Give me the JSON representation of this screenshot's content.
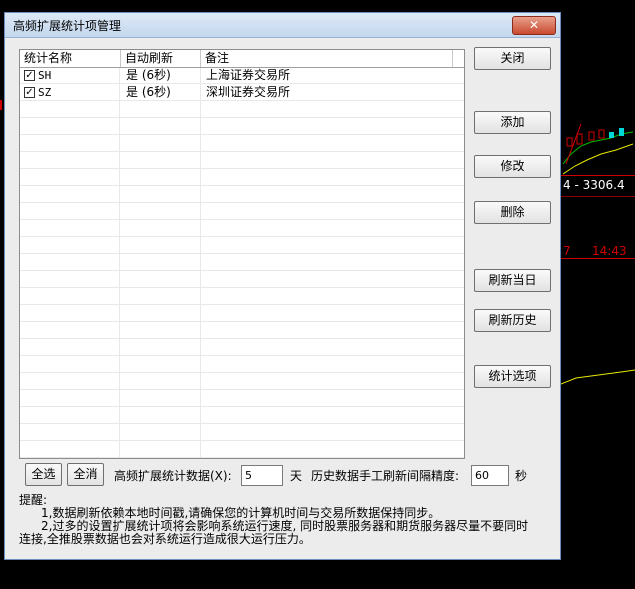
{
  "dialog": {
    "title": "高频扩展统计项管理",
    "close_glyph": "✕"
  },
  "background": {
    "price_label": "4 - 3306.4",
    "time_label": "14:43",
    "marker_label": "7"
  },
  "table": {
    "headers": [
      "统计名称",
      "自动刷新",
      "备注"
    ],
    "rows": [
      {
        "checked": true,
        "name": "SH",
        "refresh": "是 (6秒)",
        "note": "上海证券交易所"
      },
      {
        "checked": true,
        "name": "SZ",
        "refresh": "是 (6秒)",
        "note": "深圳证券交易所"
      }
    ]
  },
  "buttons": {
    "close": "关闭",
    "add": "添加",
    "modify": "修改",
    "delete": "删除",
    "refresh_today": "刷新当日",
    "refresh_history": "刷新历史",
    "stat_options": "统计选项",
    "select_all": "全选",
    "deselect_all": "全消"
  },
  "settings": {
    "count_label": "高频扩展统计数据(X):",
    "count_value": "5",
    "count_unit": "天",
    "precision_label": "历史数据手工刷新间隔精度:",
    "precision_value": "60",
    "precision_unit": "秒"
  },
  "tips": {
    "heading": "提醒:",
    "line1": "1,数据刷新依赖本地时间戳,请确保您的计算机时间与交易所数据保持同步。",
    "line2": "2,过多的设置扩展统计项将会影响系统运行速度, 同时股票服务器和期货服务器尽量不要同时",
    "line3": "连接,全推股票数据也会对系统运行造成很大运行压力。"
  },
  "colors": {
    "bg_green": "#00c000",
    "bg_red": "#d00000",
    "bg_yellow": "#e8e800",
    "bg_cyan": "#00d8d8"
  }
}
